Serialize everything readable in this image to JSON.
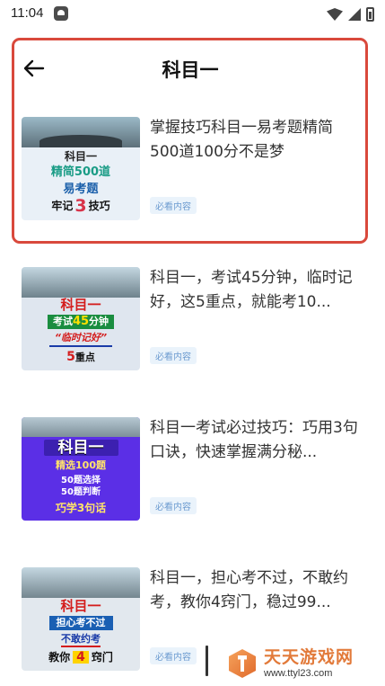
{
  "status_bar": {
    "time": "11:04",
    "app_icon": "android-notification-icon",
    "wifi_icon": "wifi-icon",
    "signal_icon": "cell-signal-icon",
    "battery_icon": "battery-icon"
  },
  "header": {
    "back_icon": "arrow-left-icon",
    "title": "科目一"
  },
  "highlight_color": "#d9493c",
  "articles": [
    {
      "title": "掌握技巧科目一易考题精简500道100分不是梦",
      "badge": "必看内容",
      "thumb": {
        "line1": "科目一",
        "line2": "精简500道",
        "line3": "易考题",
        "line4a": "牢记",
        "line4b": "3",
        "line4c": "技巧"
      }
    },
    {
      "title": "科目一，考试45分钟，临时记好，这5重点，就能考10...",
      "badge": "必看内容",
      "thumb": {
        "line1": "科目一",
        "line2a": "考试",
        "line2b": "45",
        "line2c": "分钟",
        "line3": "“临时记好”",
        "line4a": "5",
        "line4b": "重点"
      }
    },
    {
      "title": "科目一考试必过技巧：巧用3句口诀，快速掌握满分秘...",
      "badge": "必看内容",
      "thumb": {
        "line1": "科目一",
        "line2": "精选100题",
        "line3a": "50题选择",
        "line3b": "50题判断",
        "line4": "巧学3句话"
      }
    },
    {
      "title": "科目一，担心考不过，不敢约考，教你4窍门，稳过99...",
      "badge": "必看内容",
      "thumb": {
        "line1": "科目一",
        "line2": "担心考不过",
        "line3": "不敢约考",
        "line4a": "教你",
        "line4b": "4",
        "line4c": "窍门"
      }
    }
  ],
  "watermark": {
    "logo_icon": "ttyl-logo-icon",
    "name": "天天游戏网",
    "url": "www.ttyl23.com"
  }
}
